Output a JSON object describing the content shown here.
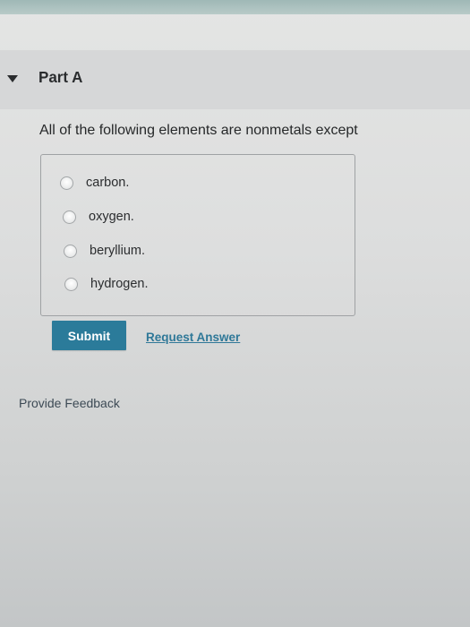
{
  "part": {
    "title": "Part A"
  },
  "question": {
    "text": "All of the following elements are nonmetals except"
  },
  "options": [
    {
      "label": "carbon.",
      "selected": false
    },
    {
      "label": "oxygen.",
      "selected": false
    },
    {
      "label": "beryllium.",
      "selected": false
    },
    {
      "label": "hydrogen.",
      "selected": false
    }
  ],
  "actions": {
    "submit_label": "Submit",
    "request_answer_label": "Request Answer",
    "provide_feedback_label": "Provide Feedback"
  },
  "colors": {
    "submit_button": "#2b7b9a",
    "link": "#2f7898",
    "header_bar": "#d6d7d8",
    "top_strip": "#a8bfbd"
  },
  "icons": {
    "collapse_toggle": "triangle-down-icon",
    "radio": "radio-unselected-icon"
  }
}
